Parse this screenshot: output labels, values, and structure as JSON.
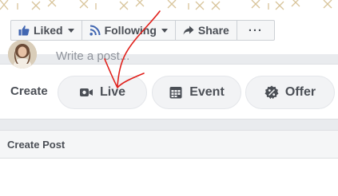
{
  "page_actions": {
    "liked_label": "Liked",
    "following_label": "Following",
    "share_label": "Share",
    "more_label": "···"
  },
  "create": {
    "label": "Create",
    "live_label": "Live",
    "event_label": "Event",
    "offer_label": "Offer"
  },
  "post": {
    "header": "Create Post",
    "placeholder": "Write a post..."
  },
  "icons": {
    "liked": "thumbs-up-icon",
    "following": "rss-feed-icon",
    "share": "share-arrow-icon",
    "live": "video-camera-icon",
    "event": "calendar-icon",
    "offer": "percent-badge-icon"
  },
  "colors": {
    "accent_blue": "#4267b2",
    "annotation_red": "#e0201b",
    "cover_gold": "#d8c49a"
  }
}
